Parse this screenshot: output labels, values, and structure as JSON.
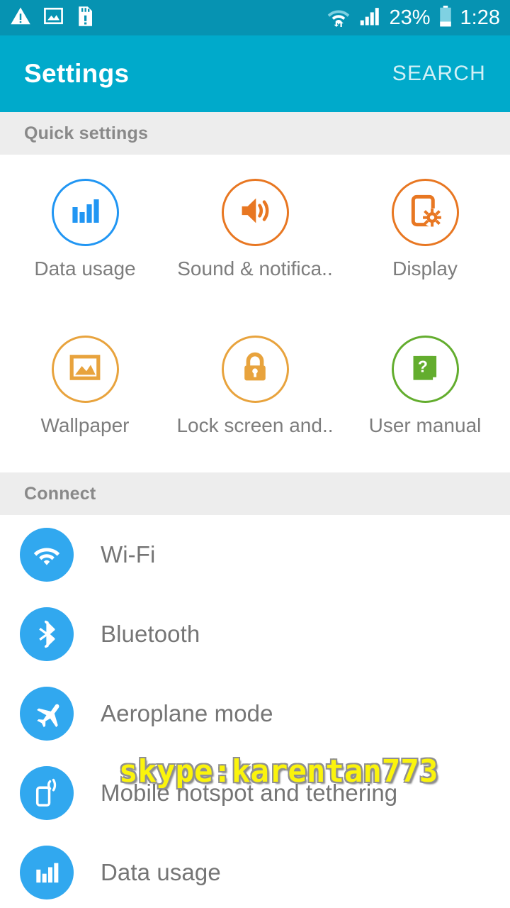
{
  "status_bar": {
    "left_icons": [
      {
        "name": "warning-triangle-icon",
        "label": "warning"
      },
      {
        "name": "screenshot-image-icon",
        "label": "screenshot"
      },
      {
        "name": "sd-card-warning-icon",
        "label": "sd-card"
      }
    ],
    "wifi_icon": "wifi-data-transfer-icon",
    "signal_icon": "cellular-signal-icon",
    "battery_percent": "23%",
    "battery_icon": "battery-icon",
    "time": "1:28"
  },
  "app_bar": {
    "title": "Settings",
    "search_label": "SEARCH"
  },
  "quick_settings": {
    "header": "Quick settings",
    "items": [
      {
        "label": "Data usage",
        "icon": "bar-chart-icon",
        "color": "#2196f3"
      },
      {
        "label": "Sound & notifica..",
        "icon": "speaker-icon",
        "color": "#e87722"
      },
      {
        "label": "Display",
        "icon": "display-gear-icon",
        "color": "#e87722"
      },
      {
        "label": "Wallpaper",
        "icon": "picture-icon",
        "color": "#e8a33d"
      },
      {
        "label": "Lock screen and..",
        "icon": "padlock-icon",
        "color": "#e8a33d"
      },
      {
        "label": "User manual",
        "icon": "book-question-icon",
        "color": "#63ad2e"
      }
    ]
  },
  "connect": {
    "header": "Connect",
    "items": [
      {
        "label": "Wi-Fi",
        "icon": "wifi-icon",
        "color": "#31a8ef"
      },
      {
        "label": "Bluetooth",
        "icon": "bluetooth-icon",
        "color": "#31a8ef"
      },
      {
        "label": "Aeroplane mode",
        "icon": "airplane-icon",
        "color": "#31a8ef"
      },
      {
        "label": "Mobile hotspot and tethering",
        "icon": "hotspot-icon",
        "color": "#31a8ef"
      },
      {
        "label": "Data usage",
        "icon": "bar-chart-icon",
        "color": "#31a8ef"
      }
    ]
  },
  "watermark": {
    "text": "skype:karentan773",
    "color": "#fbf40c"
  },
  "colors": {
    "status_bar": "#0693b2",
    "app_bar": "#00aacb",
    "section_header_bg": "#ededed",
    "list_text": "#757575"
  }
}
